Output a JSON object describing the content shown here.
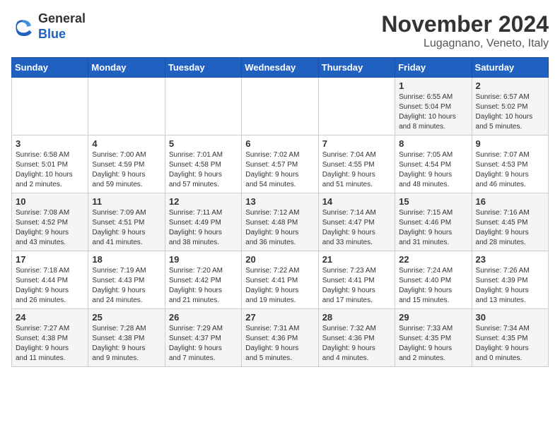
{
  "logo": {
    "general": "General",
    "blue": "Blue"
  },
  "title": "November 2024",
  "location": "Lugagnano, Veneto, Italy",
  "weekdays": [
    "Sunday",
    "Monday",
    "Tuesday",
    "Wednesday",
    "Thursday",
    "Friday",
    "Saturday"
  ],
  "weeks": [
    [
      {
        "day": "",
        "info": ""
      },
      {
        "day": "",
        "info": ""
      },
      {
        "day": "",
        "info": ""
      },
      {
        "day": "",
        "info": ""
      },
      {
        "day": "",
        "info": ""
      },
      {
        "day": "1",
        "info": "Sunrise: 6:55 AM\nSunset: 5:04 PM\nDaylight: 10 hours\nand 8 minutes."
      },
      {
        "day": "2",
        "info": "Sunrise: 6:57 AM\nSunset: 5:02 PM\nDaylight: 10 hours\nand 5 minutes."
      }
    ],
    [
      {
        "day": "3",
        "info": "Sunrise: 6:58 AM\nSunset: 5:01 PM\nDaylight: 10 hours\nand 2 minutes."
      },
      {
        "day": "4",
        "info": "Sunrise: 7:00 AM\nSunset: 4:59 PM\nDaylight: 9 hours\nand 59 minutes."
      },
      {
        "day": "5",
        "info": "Sunrise: 7:01 AM\nSunset: 4:58 PM\nDaylight: 9 hours\nand 57 minutes."
      },
      {
        "day": "6",
        "info": "Sunrise: 7:02 AM\nSunset: 4:57 PM\nDaylight: 9 hours\nand 54 minutes."
      },
      {
        "day": "7",
        "info": "Sunrise: 7:04 AM\nSunset: 4:55 PM\nDaylight: 9 hours\nand 51 minutes."
      },
      {
        "day": "8",
        "info": "Sunrise: 7:05 AM\nSunset: 4:54 PM\nDaylight: 9 hours\nand 48 minutes."
      },
      {
        "day": "9",
        "info": "Sunrise: 7:07 AM\nSunset: 4:53 PM\nDaylight: 9 hours\nand 46 minutes."
      }
    ],
    [
      {
        "day": "10",
        "info": "Sunrise: 7:08 AM\nSunset: 4:52 PM\nDaylight: 9 hours\nand 43 minutes."
      },
      {
        "day": "11",
        "info": "Sunrise: 7:09 AM\nSunset: 4:51 PM\nDaylight: 9 hours\nand 41 minutes."
      },
      {
        "day": "12",
        "info": "Sunrise: 7:11 AM\nSunset: 4:49 PM\nDaylight: 9 hours\nand 38 minutes."
      },
      {
        "day": "13",
        "info": "Sunrise: 7:12 AM\nSunset: 4:48 PM\nDaylight: 9 hours\nand 36 minutes."
      },
      {
        "day": "14",
        "info": "Sunrise: 7:14 AM\nSunset: 4:47 PM\nDaylight: 9 hours\nand 33 minutes."
      },
      {
        "day": "15",
        "info": "Sunrise: 7:15 AM\nSunset: 4:46 PM\nDaylight: 9 hours\nand 31 minutes."
      },
      {
        "day": "16",
        "info": "Sunrise: 7:16 AM\nSunset: 4:45 PM\nDaylight: 9 hours\nand 28 minutes."
      }
    ],
    [
      {
        "day": "17",
        "info": "Sunrise: 7:18 AM\nSunset: 4:44 PM\nDaylight: 9 hours\nand 26 minutes."
      },
      {
        "day": "18",
        "info": "Sunrise: 7:19 AM\nSunset: 4:43 PM\nDaylight: 9 hours\nand 24 minutes."
      },
      {
        "day": "19",
        "info": "Sunrise: 7:20 AM\nSunset: 4:42 PM\nDaylight: 9 hours\nand 21 minutes."
      },
      {
        "day": "20",
        "info": "Sunrise: 7:22 AM\nSunset: 4:41 PM\nDaylight: 9 hours\nand 19 minutes."
      },
      {
        "day": "21",
        "info": "Sunrise: 7:23 AM\nSunset: 4:41 PM\nDaylight: 9 hours\nand 17 minutes."
      },
      {
        "day": "22",
        "info": "Sunrise: 7:24 AM\nSunset: 4:40 PM\nDaylight: 9 hours\nand 15 minutes."
      },
      {
        "day": "23",
        "info": "Sunrise: 7:26 AM\nSunset: 4:39 PM\nDaylight: 9 hours\nand 13 minutes."
      }
    ],
    [
      {
        "day": "24",
        "info": "Sunrise: 7:27 AM\nSunset: 4:38 PM\nDaylight: 9 hours\nand 11 minutes."
      },
      {
        "day": "25",
        "info": "Sunrise: 7:28 AM\nSunset: 4:38 PM\nDaylight: 9 hours\nand 9 minutes."
      },
      {
        "day": "26",
        "info": "Sunrise: 7:29 AM\nSunset: 4:37 PM\nDaylight: 9 hours\nand 7 minutes."
      },
      {
        "day": "27",
        "info": "Sunrise: 7:31 AM\nSunset: 4:36 PM\nDaylight: 9 hours\nand 5 minutes."
      },
      {
        "day": "28",
        "info": "Sunrise: 7:32 AM\nSunset: 4:36 PM\nDaylight: 9 hours\nand 4 minutes."
      },
      {
        "day": "29",
        "info": "Sunrise: 7:33 AM\nSunset: 4:35 PM\nDaylight: 9 hours\nand 2 minutes."
      },
      {
        "day": "30",
        "info": "Sunrise: 7:34 AM\nSunset: 4:35 PM\nDaylight: 9 hours\nand 0 minutes."
      }
    ]
  ]
}
